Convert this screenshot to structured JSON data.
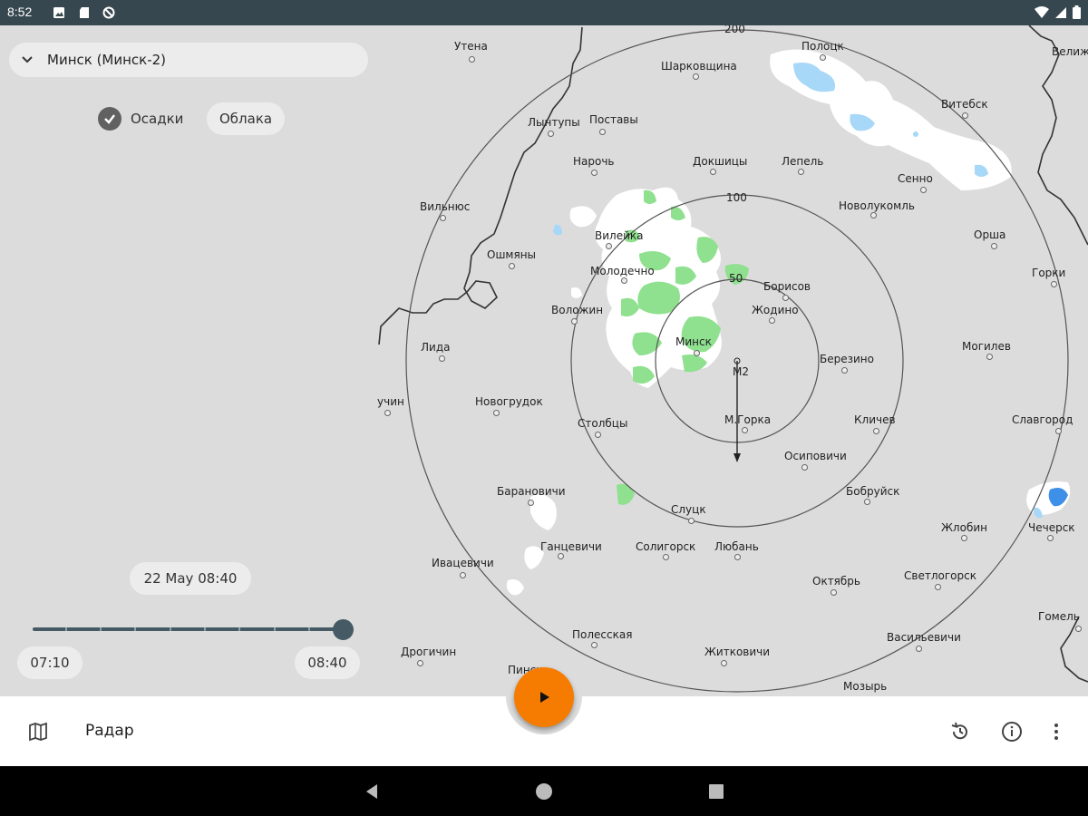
{
  "status_bar": {
    "time": "8:52",
    "notification_icons": [
      "image-notification-icon",
      "sd-card-icon",
      "no-data-icon"
    ],
    "system_icons": [
      "wifi-icon",
      "signal-icon",
      "battery-icon"
    ]
  },
  "station_selector": {
    "label": "Минск (Минск-2)",
    "icon": "chevron-down-icon"
  },
  "layers": {
    "precipitation_label": "Осадки",
    "precipitation_checked": true,
    "clouds_label": "Облака",
    "clouds_checked": false
  },
  "timeline": {
    "current_label": "22 May 08:40",
    "start_label": "07:10",
    "end_label": "08:40",
    "position_fraction": 1.0
  },
  "map": {
    "range_rings": [
      "50",
      "100",
      "200"
    ],
    "station_marker": "M2",
    "cities": [
      {
        "name": "Утена"
      },
      {
        "name": "Полоцк"
      },
      {
        "name": "Шарковщина"
      },
      {
        "name": "Велиж"
      },
      {
        "name": "Лынтупы"
      },
      {
        "name": "Поставы"
      },
      {
        "name": "Витебск"
      },
      {
        "name": "Нарочь"
      },
      {
        "name": "Докшицы"
      },
      {
        "name": "Лепель"
      },
      {
        "name": "Сенно"
      },
      {
        "name": "Вильнюс"
      },
      {
        "name": "Новолукомль"
      },
      {
        "name": "Вилейка"
      },
      {
        "name": "Орша"
      },
      {
        "name": "Ошмяны"
      },
      {
        "name": "Молодечно"
      },
      {
        "name": "Горки"
      },
      {
        "name": "Борисов"
      },
      {
        "name": "Воложин"
      },
      {
        "name": "Жодино"
      },
      {
        "name": "Лида"
      },
      {
        "name": "Минск"
      },
      {
        "name": "Могилев"
      },
      {
        "name": "Березино"
      },
      {
        "name": "учин"
      },
      {
        "name": "Новогрудок"
      },
      {
        "name": "Столбцы"
      },
      {
        "name": "М.Горка"
      },
      {
        "name": "Кличев"
      },
      {
        "name": "Славгород"
      },
      {
        "name": "Осиповичи"
      },
      {
        "name": "Барановичи"
      },
      {
        "name": "Бобруйск"
      },
      {
        "name": "Слуцк"
      },
      {
        "name": "Жлобин"
      },
      {
        "name": "Чечерск"
      },
      {
        "name": "Ганцевичи"
      },
      {
        "name": "Солигорск"
      },
      {
        "name": "Любань"
      },
      {
        "name": "Ивацевичи"
      },
      {
        "name": "Октябрь"
      },
      {
        "name": "Светлогорск"
      },
      {
        "name": "Гомель"
      },
      {
        "name": "Полесская"
      },
      {
        "name": "Дрогичин"
      },
      {
        "name": "Васильевичи"
      },
      {
        "name": "Житковичи"
      },
      {
        "name": "Пинск"
      },
      {
        "name": "Мозырь"
      }
    ],
    "colors": {
      "background": "#dcdcdc",
      "cloud": "#ffffff",
      "light_precip": "#8fe08f",
      "rain": "#a8d8f8",
      "heavy_rain": "#3d8fe8",
      "border": "#333333"
    }
  },
  "bottom_bar": {
    "title": "Радар",
    "left_icon": "map-icon",
    "play_icon": "play-icon",
    "actions": [
      "history-icon",
      "info-icon",
      "more-vert-icon"
    ],
    "fab_color": "#f57c00"
  },
  "nav_bar": {
    "buttons": [
      "back-icon",
      "home-icon",
      "recents-icon"
    ]
  }
}
